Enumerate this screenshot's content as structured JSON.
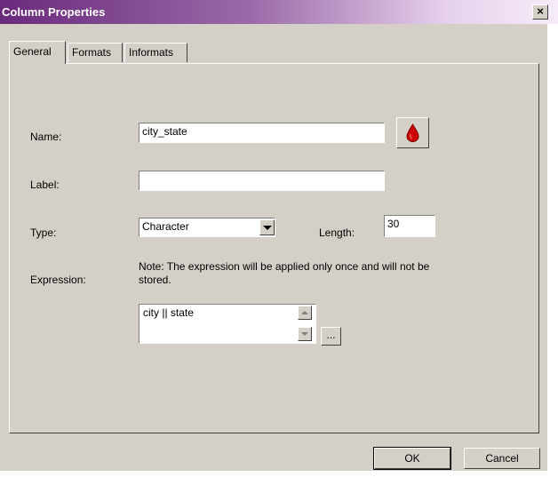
{
  "window": {
    "title": "Column Properties",
    "close_label": "×"
  },
  "tabs": [
    {
      "label": "General",
      "active": true
    },
    {
      "label": "Formats",
      "active": false
    },
    {
      "label": "Informats",
      "active": false
    }
  ],
  "general": {
    "name_label": "Name:",
    "name_value": "city_state",
    "label_label": "Label:",
    "label_value": "",
    "type_label": "Type:",
    "type_value": "Character",
    "length_label": "Length:",
    "length_value": "30",
    "expression_label": "Expression:",
    "expression_note": "Note: The expression will be applied only once and will not be stored.",
    "expression_value": "city || state",
    "expression_builder_label": "..."
  },
  "buttons": {
    "ok_label": "OK",
    "cancel_label": "Cancel"
  },
  "colors": {
    "dialog_bg": "#d4d0c8",
    "title_start": "#6a2a7c",
    "title_end": "#f6ecf8",
    "icon_red": "#cc0000"
  },
  "icons": {
    "properties_button_icon": "red-drop-icon"
  }
}
